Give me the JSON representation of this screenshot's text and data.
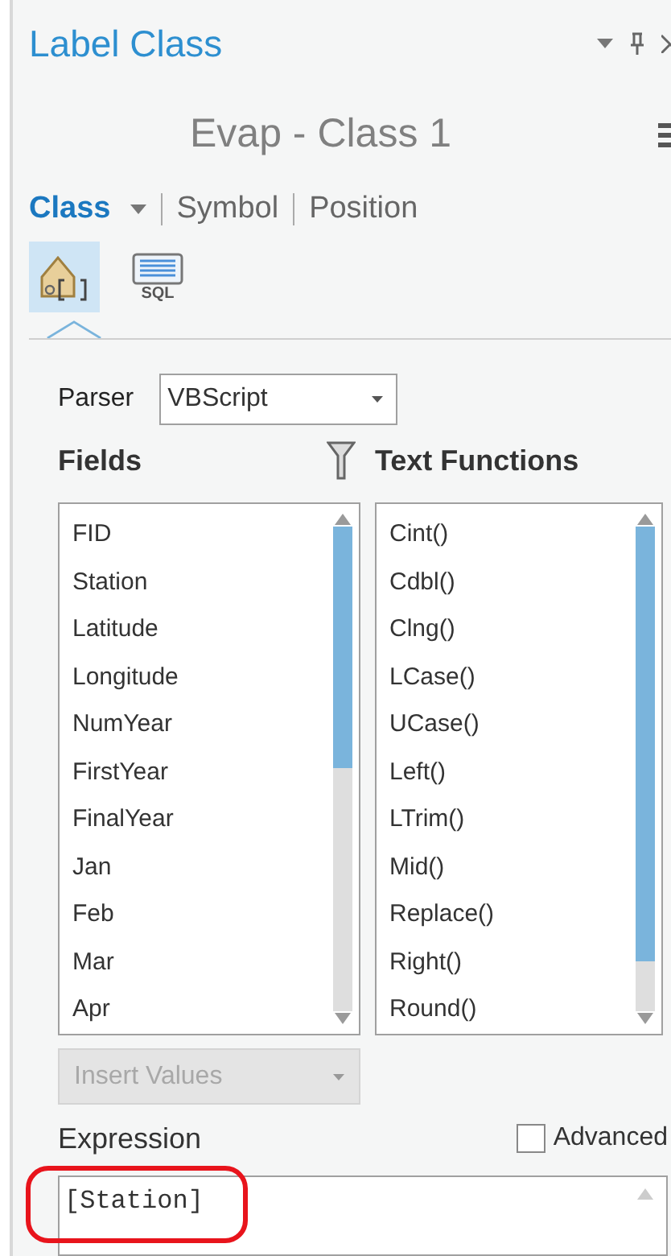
{
  "pane": {
    "title": "Label Class"
  },
  "label_class": {
    "name": "Evap - Class 1"
  },
  "tabs": [
    {
      "label": "Class",
      "selected": true,
      "has_menu": true
    },
    {
      "label": "Symbol",
      "selected": false,
      "has_menu": false
    },
    {
      "label": "Position",
      "selected": false,
      "has_menu": false
    }
  ],
  "modes": [
    {
      "kind": "expression",
      "selected": true
    },
    {
      "kind": "sql",
      "label": "SQL",
      "selected": false
    }
  ],
  "parser": {
    "label": "Parser",
    "value": "VBScript"
  },
  "fields": {
    "title": "Fields",
    "items": [
      "FID",
      "Station",
      "Latitude",
      "Longitude",
      "NumYear",
      "FirstYear",
      "FinalYear",
      "Jan",
      "Feb",
      "Mar",
      "Apr"
    ]
  },
  "functions": {
    "title": "Text Functions",
    "items": [
      "Cint()",
      "Cdbl()",
      "Clng()",
      "LCase()",
      "UCase()",
      "Left()",
      "LTrim()",
      "Mid()",
      "Replace()",
      "Right()",
      "Round()"
    ]
  },
  "insert_values": {
    "label": "Insert Values",
    "disabled": true
  },
  "expression": {
    "title": "Expression",
    "value": "[Station]",
    "highlighted": true
  },
  "advanced": {
    "label": "Advanced",
    "checked": false
  }
}
